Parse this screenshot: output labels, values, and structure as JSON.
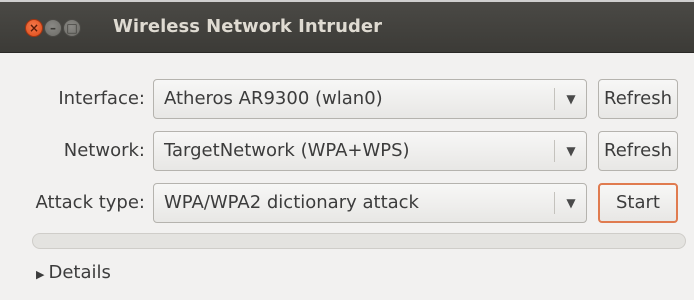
{
  "window": {
    "title": "Wireless Network Intruder",
    "controls": {
      "close": "×",
      "minimize": "–",
      "maximize": "□"
    }
  },
  "form": {
    "interface": {
      "label": "Interface:",
      "value": "Atheros AR9300 (wlan0)",
      "button": "Refresh"
    },
    "network": {
      "label": "Network:",
      "value": "TargetNetwork (WPA+WPS)",
      "button": "Refresh"
    },
    "attack_type": {
      "label": "Attack type:",
      "value": "WPA/WPA2 dictionary attack",
      "button": "Start"
    }
  },
  "progress": {
    "fraction": 0.0
  },
  "details": {
    "label": "Details",
    "expanded": false
  },
  "icons": {
    "dropdown": "chevron-down-icon",
    "expander": "triangle-right-icon",
    "dropdown_glyph": "▼",
    "expander_glyph": "▶"
  },
  "colors": {
    "titlebar": "#3c3b37",
    "title_text": "#dfdbd2",
    "close_button": "#df4a16",
    "focus_accent": "#e07b4f",
    "window_bg": "#f2f1f0"
  }
}
